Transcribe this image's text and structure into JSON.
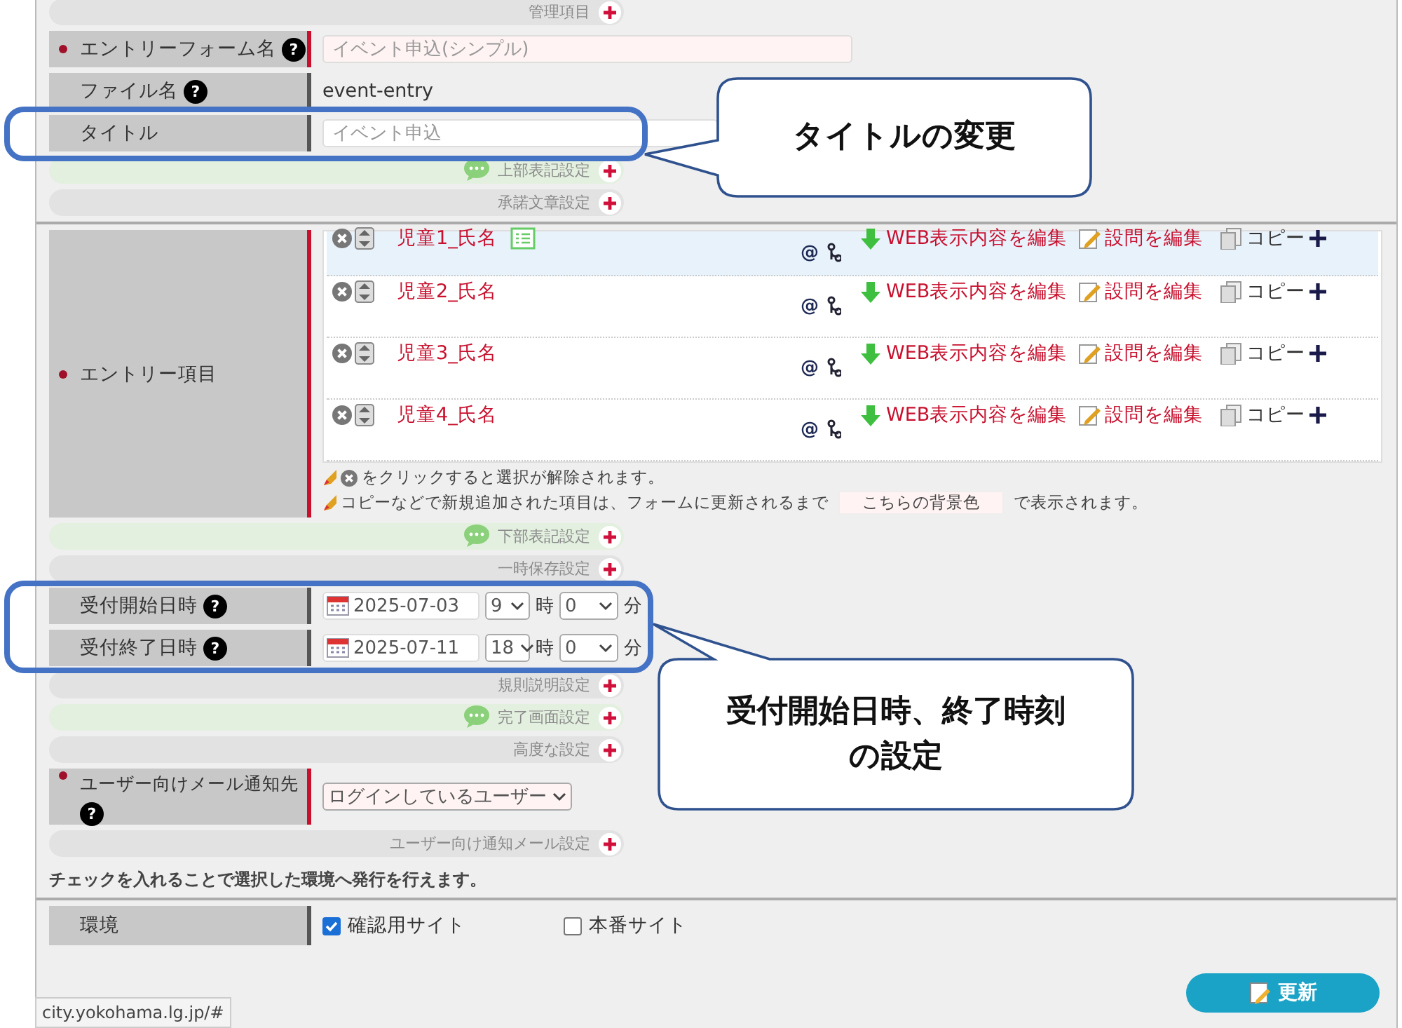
{
  "form": [
    {
      "kind": "bar",
      "label": "管理項目",
      "comment": false
    },
    {
      "kind": "field",
      "label": "エントリーフォーム名",
      "required": true,
      "help": "?",
      "placeholder": "イベント申込(シンプル)"
    },
    {
      "kind": "text",
      "label": "ファイル名",
      "required": false,
      "help": "?",
      "value": "event-entry"
    },
    {
      "kind": "field",
      "label": "タイトル",
      "required": false,
      "placeholder": "イベント申込"
    },
    {
      "kind": "bar",
      "label": "上部表記設定",
      "comment": true
    },
    {
      "kind": "bar",
      "label": "承諾文章設定",
      "comment": false
    },
    {
      "kind": "divider"
    },
    {
      "kind": "entries",
      "label": "エントリー項目",
      "required": true,
      "items": [
        {
          "name": "児童1_氏名",
          "selected": true,
          "list_icon": true,
          "mark": "@",
          "web_edit": "WEB表示内容を編集",
          "question_edit": "設問を編集",
          "copy": "コピー"
        },
        {
          "name": "児童2_氏名",
          "selected": false,
          "list_icon": false,
          "mark": "@",
          "web_edit": "WEB表示内容を編集",
          "question_edit": "設問を編集",
          "copy": "コピー"
        },
        {
          "name": "児童3_氏名",
          "selected": false,
          "list_icon": false,
          "mark": "@",
          "web_edit": "WEB表示内容を編集",
          "question_edit": "設問を編集",
          "copy": "コピー"
        },
        {
          "name": "児童4_氏名",
          "selected": false,
          "list_icon": false,
          "mark": "@",
          "web_edit": "WEB表示内容を編集",
          "question_edit": "設問を編集",
          "copy": "コピー"
        }
      ],
      "notes": [
        {
          "text": "をクリックすると選択が解除されます。",
          "clear_icon": true
        },
        {
          "text": "コピーなどで新規追加された項目は、フォームに更新されるまで",
          "swatch": "こちらの背景色",
          "after": "で表示されます。",
          "clear_icon": false
        }
      ]
    },
    {
      "kind": "bar",
      "label": "下部表記設定",
      "comment": true
    },
    {
      "kind": "bar",
      "label": "一時保存設定",
      "comment": false
    },
    {
      "kind": "datetime",
      "label": "受付開始日時",
      "help": "?",
      "date": "2025-07-03",
      "hour": "9",
      "hour_unit": "時",
      "minute": "0",
      "minute_unit": "分"
    },
    {
      "kind": "datetime",
      "label": "受付終了日時",
      "help": "?",
      "date": "2025-07-11",
      "hour": "18",
      "hour_unit": "時",
      "minute": "0",
      "minute_unit": "分"
    },
    {
      "kind": "bar",
      "label": "規則説明設定",
      "comment": false
    },
    {
      "kind": "bar",
      "label": "完了画面設定",
      "comment": true
    },
    {
      "kind": "bar",
      "label": "高度な設定",
      "comment": false
    },
    {
      "kind": "select",
      "label": "ユーザー向けメール通知先",
      "required": true,
      "help": "?",
      "value": "ログインしているユーザー"
    },
    {
      "kind": "bar",
      "label": "ユーザー向け通知メール設定",
      "comment": false
    },
    {
      "kind": "instruction",
      "text": "チェックを入れることで選択した環境へ発行を行えます。"
    },
    {
      "kind": "divider"
    },
    {
      "kind": "checks",
      "label": "環境",
      "options": [
        {
          "label": "確認用サイト",
          "checked": true
        },
        {
          "label": "本番サイト",
          "checked": false
        }
      ]
    }
  ],
  "submit": "更新",
  "status_bar": "city.yokohama.lg.jp/#",
  "callouts": [
    {
      "text": "タイトルの変更"
    },
    {
      "lines": [
        "受付開始日時、終了時刻",
        "の設定"
      ]
    }
  ]
}
